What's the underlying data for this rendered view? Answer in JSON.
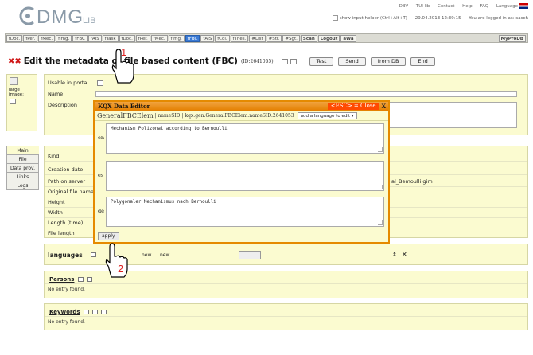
{
  "header": {
    "logo_dm": "DMG",
    "logo_lib": "LIB",
    "top_links": [
      "DBV",
      "TUI lib",
      "Contact",
      "Help",
      "FAQ",
      "Language"
    ],
    "show_helper_label": "show input helper (Ctrl+Alt+T)",
    "date": "29.04.2013 12:39:15",
    "logged_in": "You are logged in as: sasch"
  },
  "toolbar": {
    "items": [
      {
        "label": "fDoc.",
        "active": false,
        "bold": false
      },
      {
        "label": "fPer.",
        "active": false,
        "bold": false
      },
      {
        "label": "fMec.",
        "active": false,
        "bold": false
      },
      {
        "label": "fImg.",
        "active": false,
        "bold": false
      },
      {
        "label": "fFBC",
        "active": false,
        "bold": false
      },
      {
        "label": "fAIS",
        "active": false,
        "bold": false
      },
      {
        "label": "fTask",
        "active": false,
        "bold": false
      },
      {
        "label": "fDoc.",
        "active": false,
        "bold": false
      },
      {
        "label": "fPer.",
        "active": false,
        "bold": false
      },
      {
        "label": "fMec.",
        "active": false,
        "bold": false
      },
      {
        "label": "fImg.",
        "active": false,
        "bold": false
      },
      {
        "label": "fFBC",
        "active": true,
        "bold": false
      },
      {
        "label": "fAIS",
        "active": false,
        "bold": false
      },
      {
        "label": "fCol.",
        "active": false,
        "bold": false
      },
      {
        "label": "fThes.",
        "active": false,
        "bold": false
      },
      {
        "label": "#List",
        "active": false,
        "bold": false
      },
      {
        "label": "#Str.",
        "active": false,
        "bold": false
      },
      {
        "label": "#Sgt.",
        "active": false,
        "bold": false
      },
      {
        "label": "Scan",
        "active": false,
        "bold": true
      },
      {
        "label": "Logout",
        "active": false,
        "bold": true
      },
      {
        "label": "aWa",
        "active": false,
        "bold": true
      }
    ],
    "right_label": "MyProDB"
  },
  "title": {
    "text": "Edit the metadata of file based content (FBC)",
    "id": "(ID:2641055)",
    "buttons": [
      "Test",
      "Send",
      "from DB",
      "End"
    ]
  },
  "left_image": {
    "label": "large image:"
  },
  "fields_top": {
    "usable": "Usable in portal :",
    "name": "Name",
    "description": "Description"
  },
  "side_tabs": [
    "Main",
    "File",
    "Data prov.",
    "Links",
    "Logs"
  ],
  "fields_main": {
    "labels": [
      "Kind",
      "Creation date",
      "Path on server",
      "Original file name",
      "Height",
      "Width",
      "Length (time)",
      "File length"
    ],
    "path_value": "al_Bemoulli.gim"
  },
  "languages": {
    "label": "languages",
    "new1": "new",
    "new2": "new"
  },
  "persons": {
    "label": "Persons",
    "empty": "No entry found."
  },
  "keywords": {
    "label": "Keywords",
    "empty": "No entry found."
  },
  "modal": {
    "title": "KQX Data Editor",
    "esc": "<ESC> = Close",
    "close": "X",
    "elem_name": "GeneralFBCElem",
    "sep": " | nameSID | ",
    "elem_id": "kqx.gen.GeneralFBCElem.nameSID.2641053",
    "add_lang": "add a language to edit",
    "rows": [
      {
        "code": "en",
        "text": "Mechanism Polizonal according to Bernoulli"
      },
      {
        "code": "es",
        "text": ""
      },
      {
        "code": "de",
        "text": "Polygonaler Mechanismus nach Bernoulli"
      }
    ],
    "apply": "apply"
  },
  "annotations": {
    "step1": "1",
    "step2": "2"
  }
}
